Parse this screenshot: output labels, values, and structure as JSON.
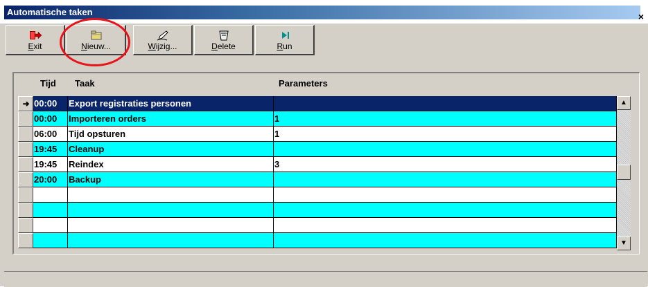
{
  "window": {
    "title": "Automatische taken",
    "close_label": "×"
  },
  "toolbar": {
    "exit_label": "Exit",
    "new_label": "Nieuw...",
    "edit_label": "Wijzig...",
    "delete_label": "Delete",
    "run_label": "Run"
  },
  "grid": {
    "columns": [
      "Tijd",
      "Taak",
      "Parameters"
    ],
    "rows": [
      {
        "time": "00:00",
        "task": "Export registraties personen",
        "params": ""
      },
      {
        "time": "00:00",
        "task": "Importeren orders",
        "params": "1"
      },
      {
        "time": "06:00",
        "task": "Tijd opsturen",
        "params": "1"
      },
      {
        "time": "19:45",
        "task": "Cleanup",
        "params": ""
      },
      {
        "time": "19:45",
        "task": "Reindex",
        "params": "3"
      },
      {
        "time": "20:00",
        "task": "Backup",
        "params": ""
      },
      {
        "time": "",
        "task": "",
        "params": ""
      },
      {
        "time": "",
        "task": "",
        "params": ""
      },
      {
        "time": "",
        "task": "",
        "params": ""
      },
      {
        "time": "",
        "task": "",
        "params": ""
      }
    ],
    "current_row_marker": "➜"
  },
  "colors": {
    "row_alt": "#00ffff",
    "selection": "#0a246a",
    "highlight_circle": "#e8141b"
  }
}
